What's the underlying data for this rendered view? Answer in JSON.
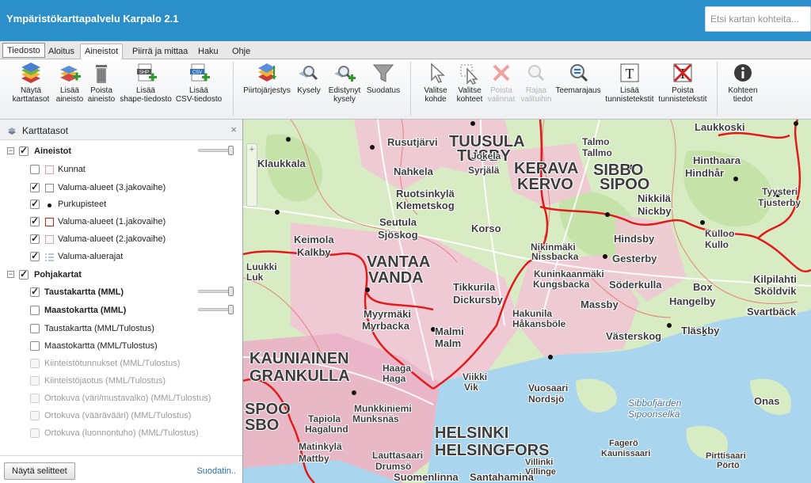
{
  "header": {
    "title": "Ympäristökarttapalvelu Karpalo 2.1",
    "search_placeholder": "Etsi kartan kohteita..."
  },
  "tabs": [
    {
      "label": "Tiedosto"
    },
    {
      "label": "Aloitus"
    },
    {
      "label": "Aineistot",
      "active": true
    },
    {
      "label": "Piirrä ja mittaa"
    },
    {
      "label": "Haku"
    },
    {
      "label": "Ohje"
    }
  ],
  "ribbon": {
    "buttons": [
      {
        "line1": "Näytä",
        "line2": "karttatasot",
        "icon": "layers-icon"
      },
      {
        "line1": "Lisää",
        "line2": "aineisto",
        "icon": "add-layer-icon"
      },
      {
        "line1": "Poista",
        "line2": "aineisto",
        "icon": "trash-icon"
      },
      {
        "line1": "Lisää",
        "line2": "shape-tiedosto",
        "icon": "shp-file-icon"
      },
      {
        "line1": "Lisää",
        "line2": "CSV-tiedosto",
        "icon": "csv-file-icon"
      },
      {
        "line1": "Piirtojärjestys",
        "line2": "",
        "icon": "draw-order-icon"
      },
      {
        "line1": "Kysely",
        "line2": "",
        "icon": "query-icon"
      },
      {
        "line1": "Edistynyt",
        "line2": "kysely",
        "icon": "advanced-query-icon"
      },
      {
        "line1": "Suodatus",
        "line2": "",
        "icon": "filter-icon"
      },
      {
        "line1": "Valitse",
        "line2": "kohde",
        "icon": "select-arrow-icon"
      },
      {
        "line1": "Valitse",
        "line2": "kohteet",
        "icon": "select-area-icon"
      },
      {
        "line1": "Poista",
        "line2": "valinnat",
        "icon": "clear-selection-icon",
        "disabled": true
      },
      {
        "line1": "Rajaa",
        "line2": "valituihin",
        "icon": "zoom-selected-icon",
        "disabled": true
      },
      {
        "line1": "Teemarajaus",
        "line2": "",
        "icon": "theme-filter-icon"
      },
      {
        "line1": "Lisää",
        "line2": "tunnistetekstit",
        "icon": "add-label-icon"
      },
      {
        "line1": "Poista",
        "line2": "tunnistetekstit",
        "icon": "remove-label-icon"
      },
      {
        "line1": "Kohteen",
        "line2": "tiedot",
        "icon": "info-icon"
      }
    ]
  },
  "layer_panel": {
    "title": "Karttatasot",
    "groups": [
      {
        "label": "Aineistot",
        "checked": true,
        "opacity": 1.0,
        "layers": [
          {
            "label": "Kunnat",
            "checked": false,
            "legend": "outline-pink",
            "legend_color": "#e3a2a2"
          },
          {
            "label": "Valuma-alueet (3.jakovaihe)",
            "checked": true,
            "legend": "outline-gray",
            "legend_color": "#8a8a8a"
          },
          {
            "label": "Purkupisteet",
            "checked": true,
            "legend": "dot",
            "legend_color": "#111111"
          },
          {
            "label": "Valuma-alueet (1.jakovaihe)",
            "checked": true,
            "legend": "outline-red",
            "legend_color": "#d42020"
          },
          {
            "label": "Valuma-alueet (2.jakovaihe)",
            "checked": true,
            "legend": "outline-lightred",
            "legend_color": "#e8a0a0"
          },
          {
            "label": "Valuma-aluerajat",
            "checked": true,
            "legend": "lines",
            "legend_color": "#6b8fb5"
          }
        ]
      },
      {
        "label": "Pohjakartat",
        "checked": true,
        "layers": [
          {
            "label": "Taustakartta (MML)",
            "checked": true,
            "bold": true,
            "slider": true,
            "opacity": 1.0
          },
          {
            "label": "Maastokartta (MML)",
            "checked": false,
            "bold": true,
            "slider": true,
            "opacity": 1.0
          },
          {
            "label": "Taustakartta (MML/Tulostus)",
            "checked": false
          },
          {
            "label": "Maastokartta (MML/Tulostus)",
            "checked": false
          },
          {
            "label": "Kiinteistötunnukset (MML/Tulostus)",
            "checked": false,
            "disabled": true
          },
          {
            "label": "Kiinteistöjaotus (MML/Tulostus)",
            "checked": false,
            "disabled": true
          },
          {
            "label": "Ortokuva (väri/mustavalko) (MML/Tulostus)",
            "checked": false,
            "disabled": true
          },
          {
            "label": "Ortokuva (väärävääri) (MML/Tulostus)",
            "checked": false,
            "disabled": true
          },
          {
            "label": "Ortokuva (luonnontuho) (MML/Tulostus)",
            "checked": false,
            "disabled": true
          }
        ]
      }
    ],
    "footer": {
      "legend_button": "Näytä selitteet",
      "filter_link": "Suodatin.."
    }
  },
  "map": {
    "colors": {
      "land": "#d8ecc4",
      "urban": "#f2c6d6",
      "urban_dark": "#eab3c8",
      "water": "#a9d6ee",
      "forest": "#c5e3a8",
      "boundary_major": "#e01b1b",
      "boundary_minor": "#e86a6a",
      "road": "#ffffff"
    },
    "labels": [
      {
        "text": "Laukkoski",
        "size": 13,
        "kind": "place"
      },
      {
        "text": "Klaukkala",
        "size": 13,
        "kind": "place"
      },
      {
        "text": "Rusutjärvi",
        "size": 13,
        "kind": "place"
      },
      {
        "text": "TUUSULA",
        "size": 20,
        "kind": "city"
      },
      {
        "text": "TUSBY",
        "size": 20,
        "kind": "city"
      },
      {
        "text": "Talmo",
        "size": 12,
        "kind": "place"
      },
      {
        "text": "Tallmo",
        "size": 12,
        "kind": "place"
      },
      {
        "text": "Nahkela",
        "size": 13,
        "kind": "place"
      },
      {
        "text": "Jokela",
        "size": 12,
        "kind": "place"
      },
      {
        "text": "Syrjälä",
        "size": 12,
        "kind": "place"
      },
      {
        "text": "KERAVA",
        "size": 20,
        "kind": "city"
      },
      {
        "text": "KERVO",
        "size": 20,
        "kind": "city"
      },
      {
        "text": "SIPOO",
        "size": 20,
        "kind": "city"
      },
      {
        "text": "SIBBO",
        "size": 20,
        "kind": "city"
      },
      {
        "text": "Hinthaara",
        "size": 13,
        "kind": "place"
      },
      {
        "text": "Hindhår",
        "size": 13,
        "kind": "place"
      },
      {
        "text": "Ruotsinkylä",
        "size": 13,
        "kind": "place"
      },
      {
        "text": "Klemetskog",
        "size": 13,
        "kind": "place"
      },
      {
        "text": "Nikkilä",
        "size": 13,
        "kind": "place"
      },
      {
        "text": "Nickby",
        "size": 13,
        "kind": "place"
      },
      {
        "text": "Tyysteri",
        "size": 12,
        "kind": "place"
      },
      {
        "text": "Tjusterby",
        "size": 12,
        "kind": "place"
      },
      {
        "text": "Seutula",
        "size": 13,
        "kind": "place"
      },
      {
        "text": "Sjöskog",
        "size": 13,
        "kind": "place"
      },
      {
        "text": "Korso",
        "size": 13,
        "kind": "place"
      },
      {
        "text": "Keimola",
        "size": 13,
        "kind": "place"
      },
      {
        "text": "Kalkby",
        "size": 13,
        "kind": "place"
      },
      {
        "text": "Hindsby",
        "size": 13,
        "kind": "place"
      },
      {
        "text": "Kulloo",
        "size": 12,
        "kind": "place"
      },
      {
        "text": "Kullo",
        "size": 12,
        "kind": "place"
      },
      {
        "text": "Nikinmäki",
        "size": 12,
        "kind": "place"
      },
      {
        "text": "Nissbacka",
        "size": 12,
        "kind": "place"
      },
      {
        "text": "Gesterby",
        "size": 13,
        "kind": "place"
      },
      {
        "text": "VANTAA",
        "size": 20,
        "kind": "city"
      },
      {
        "text": "VANDA",
        "size": 20,
        "kind": "city"
      },
      {
        "text": "Luukki",
        "size": 12,
        "kind": "place"
      },
      {
        "text": "Luk",
        "size": 12,
        "kind": "place"
      },
      {
        "text": "Kuninkaanmäki",
        "size": 12,
        "kind": "place"
      },
      {
        "text": "Kungsbacka",
        "size": 12,
        "kind": "place"
      },
      {
        "text": "Söderkulla",
        "size": 13,
        "kind": "place"
      },
      {
        "text": "Box",
        "size": 13,
        "kind": "place"
      },
      {
        "text": "Kilpilahti",
        "size": 13,
        "kind": "place"
      },
      {
        "text": "Sköldvik",
        "size": 13,
        "kind": "place"
      },
      {
        "text": "Tikkurila",
        "size": 13,
        "kind": "place"
      },
      {
        "text": "Dickursby",
        "size": 13,
        "kind": "place"
      },
      {
        "text": "Massby",
        "size": 13,
        "kind": "place"
      },
      {
        "text": "Hangelby",
        "size": 13,
        "kind": "place"
      },
      {
        "text": "Myyrmäki",
        "size": 13,
        "kind": "place"
      },
      {
        "text": "Myrbacka",
        "size": 13,
        "kind": "place"
      },
      {
        "text": "Hakunila",
        "size": 12,
        "kind": "place"
      },
      {
        "text": "Håkansböle",
        "size": 12,
        "kind": "place"
      },
      {
        "text": "Malmi",
        "size": 13,
        "kind": "place"
      },
      {
        "text": "Malm",
        "size": 13,
        "kind": "place"
      },
      {
        "text": "Västerskog",
        "size": 13,
        "kind": "place"
      },
      {
        "text": "Tläskby",
        "size": 13,
        "kind": "place"
      },
      {
        "text": "Svartbäck",
        "size": 13,
        "kind": "place"
      },
      {
        "text": "KAUNIAINEN",
        "size": 20,
        "kind": "city"
      },
      {
        "text": "GRANKULLA",
        "size": 20,
        "kind": "city"
      },
      {
        "text": "Haaga",
        "size": 12,
        "kind": "place"
      },
      {
        "text": "Haga",
        "size": 12,
        "kind": "place"
      },
      {
        "text": "Viikki",
        "size": 12,
        "kind": "place"
      },
      {
        "text": "Vik",
        "size": 12,
        "kind": "place"
      },
      {
        "text": "Vuosaari",
        "size": 12,
        "kind": "place"
      },
      {
        "text": "Nordsjö",
        "size": 12,
        "kind": "place"
      },
      {
        "text": "Sipoonselkä",
        "size": 12,
        "kind": "water"
      },
      {
        "text": "Sibbofjärden",
        "size": 12,
        "kind": "water"
      },
      {
        "text": "Onas",
        "size": 13,
        "kind": "place"
      },
      {
        "text": "SPOO",
        "size": 20,
        "kind": "city"
      },
      {
        "text": "SBO",
        "size": 20,
        "kind": "city"
      },
      {
        "text": "Tapiola",
        "size": 12,
        "kind": "place"
      },
      {
        "text": "Hagalund",
        "size": 12,
        "kind": "place"
      },
      {
        "text": "Munkkiniemi",
        "size": 12,
        "kind": "place"
      },
      {
        "text": "Munksnäs",
        "size": 12,
        "kind": "place"
      },
      {
        "text": "HELSINKI",
        "size": 20,
        "kind": "city"
      },
      {
        "text": "HELSINGFORS",
        "size": 20,
        "kind": "city"
      },
      {
        "text": "Villinki",
        "size": 11,
        "kind": "place"
      },
      {
        "text": "Villinge",
        "size": 11,
        "kind": "place"
      },
      {
        "text": "Fagerö",
        "size": 11,
        "kind": "place"
      },
      {
        "text": "Kaunissaari",
        "size": 11,
        "kind": "place"
      },
      {
        "text": "Pirttisaari",
        "size": 11,
        "kind": "place"
      },
      {
        "text": "Pörtö",
        "size": 11,
        "kind": "place"
      },
      {
        "text": "Matinkylä",
        "size": 12,
        "kind": "place"
      },
      {
        "text": "Mattby",
        "size": 12,
        "kind": "place"
      },
      {
        "text": "Lauttasaari",
        "size": 12,
        "kind": "place"
      },
      {
        "text": "Drumsö",
        "size": 12,
        "kind": "place"
      },
      {
        "text": "Suomenlinna",
        "size": 13,
        "kind": "place"
      },
      {
        "text": "Santahamina",
        "size": 13,
        "kind": "place"
      }
    ]
  }
}
